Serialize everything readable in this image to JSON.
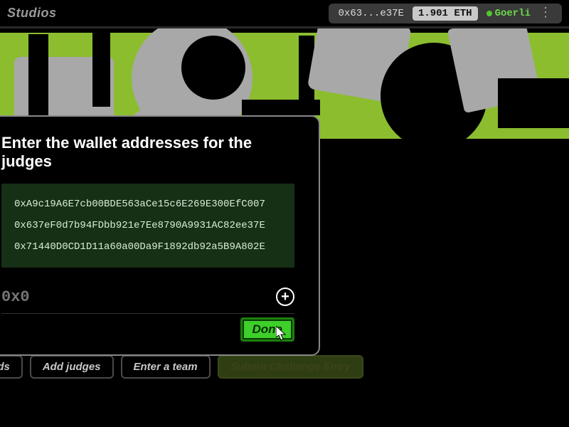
{
  "topbar": {
    "brand": "Studios",
    "wallet": {
      "addr_short": "0x63...e37E",
      "balance": "1.901 ETH",
      "network": "Goerli"
    }
  },
  "modal": {
    "title": "Enter the wallet addresses for the judges",
    "addresses": [
      "0xA9c19A6E7cb00BDE563aCe15c6E269E300EfC007",
      "0x637eF0d7b94FDbb921e7Ee8790A9931AC82ee37E",
      "0x71440D0CD1D11a60a00Da9F1892db92a5B9A802E"
    ],
    "input_placeholder": "0x0",
    "done_label": "Done"
  },
  "actions": {
    "rounds": "unds",
    "add_judges": "Add judges",
    "enter_team": "Enter a team",
    "submit": "Submit Challenge Entry"
  },
  "colors": {
    "accent_green": "#3ecf2a",
    "hero_green": "#8bbd2f"
  }
}
